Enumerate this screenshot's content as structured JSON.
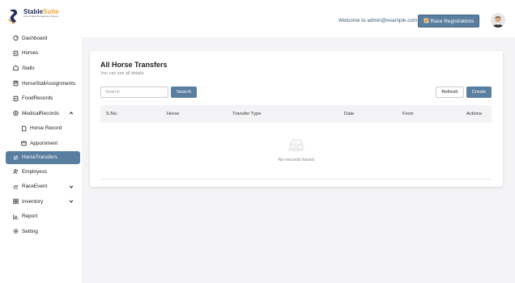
{
  "brand": {
    "name_part1": "Stable",
    "name_part2": "Suite",
    "tagline": "Horse Stable Management System"
  },
  "header": {
    "welcome": "Welcome to admin@example.com",
    "race_button": "Race Registrations"
  },
  "sidebar": {
    "items": [
      {
        "label": "Dashboard",
        "icon": "dashboard-icon"
      },
      {
        "label": "Horses",
        "icon": "horse-icon"
      },
      {
        "label": "Stalls",
        "icon": "stalls-icon"
      },
      {
        "label": "HorseStallAssignments",
        "icon": "assignment-icon"
      },
      {
        "label": "FoodRecords",
        "icon": "food-icon"
      },
      {
        "label": "MedicalRecords",
        "icon": "medical-icon"
      },
      {
        "label": "Horse Record",
        "icon": "record-icon"
      },
      {
        "label": "Apponiment",
        "icon": "calendar-icon"
      },
      {
        "label": "HorseTransfers",
        "icon": "transfer-icon"
      },
      {
        "label": "Employess",
        "icon": "employees-icon"
      },
      {
        "label": "RaceEvent",
        "icon": "race-icon"
      },
      {
        "label": "Inventory",
        "icon": "inventory-icon"
      },
      {
        "label": "Report",
        "icon": "report-icon"
      },
      {
        "label": "Setting",
        "icon": "gear-icon"
      }
    ]
  },
  "main": {
    "title": "All Horse Transfers",
    "subtitle": "You can see all details",
    "search_placeholder": "Search",
    "search_button": "Search",
    "refresh_button": "Refresh",
    "create_button": "Create",
    "columns": [
      "S.No.",
      "Horse",
      "Transfer Type",
      "Date",
      "From",
      "Actions"
    ],
    "empty_text": "No records found"
  },
  "colors": {
    "accent": "#5a7ea0",
    "brand_dark": "#1f2d5a",
    "brand_orange": "#e9a23b",
    "background": "#f4f4f6"
  }
}
